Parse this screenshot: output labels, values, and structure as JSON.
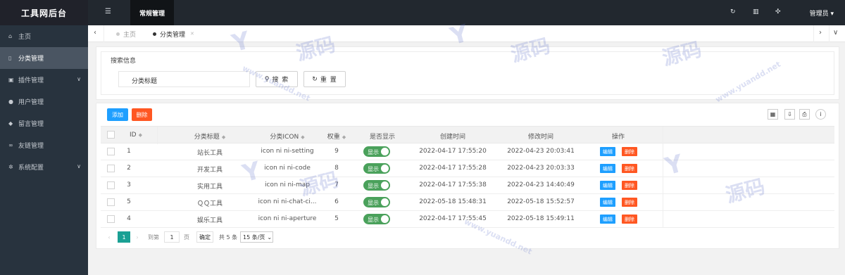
{
  "app": {
    "title": "工具网后台"
  },
  "sidebar": {
    "items": [
      {
        "label": "主页",
        "icon": "home-icon"
      },
      {
        "label": "分类管理",
        "icon": "bookmark-icon",
        "active": true
      },
      {
        "label": "插件管理",
        "icon": "sitemap-icon",
        "expandable": true
      },
      {
        "label": "用户管理",
        "icon": "user-icon"
      },
      {
        "label": "留言管理",
        "icon": "comments-icon"
      },
      {
        "label": "友链管理",
        "icon": "link-icon"
      },
      {
        "label": "系统配置",
        "icon": "cogs-icon",
        "expandable": true
      }
    ]
  },
  "header": {
    "top_tab": "常规管理",
    "admin_label": "管理员",
    "icons": [
      "refresh-icon",
      "trash-icon",
      "fullscreen-icon"
    ]
  },
  "tabs": {
    "items": [
      {
        "label": "主页",
        "active": false
      },
      {
        "label": "分类管理",
        "active": true
      }
    ]
  },
  "search": {
    "legend": "搜索信息",
    "field_label": "分类标题",
    "search_label": "搜 索",
    "reset_label": "重 置"
  },
  "toolbar": {
    "add_label": "添加",
    "delete_label": "删除",
    "add_color": "#1e9fff",
    "delete_color": "#ff5722"
  },
  "table": {
    "headers": [
      "ID",
      "分类标题",
      "分类ICON",
      "权重",
      "是否显示",
      "创建时间",
      "修改时间",
      "操作"
    ],
    "rows": [
      {
        "id": "1",
        "title": "站长工具",
        "icon": "icon ni ni-setting",
        "weight": "9",
        "show": "显示",
        "created": "2022-04-17 17:55:20",
        "modified": "2022-04-23 20:03:41"
      },
      {
        "id": "2",
        "title": "开发工具",
        "icon": "icon ni ni-code",
        "weight": "8",
        "show": "显示",
        "created": "2022-04-17 17:55:28",
        "modified": "2022-04-23 20:03:33"
      },
      {
        "id": "3",
        "title": "实用工具",
        "icon": "icon ni ni-map",
        "weight": "7",
        "show": "显示",
        "created": "2022-04-17 17:55:38",
        "modified": "2022-04-23 14:40:49"
      },
      {
        "id": "5",
        "title": "ＱＱ工具",
        "icon": "icon ni ni-chat-ci...",
        "weight": "6",
        "show": "显示",
        "created": "2022-05-18 15:48:31",
        "modified": "2022-05-18 15:52:57"
      },
      {
        "id": "4",
        "title": "娱乐工具",
        "icon": "icon ni ni-aperture",
        "weight": "5",
        "show": "显示",
        "created": "2022-04-17 17:55:45",
        "modified": "2022-05-18 15:49:11"
      }
    ],
    "edit_label": "编辑",
    "delete_label": "删除",
    "switch_color": "#4aa15b"
  },
  "pager": {
    "current": "1",
    "goto_label": "到第",
    "goto_value": "1",
    "page_label": "页",
    "confirm_label": "确定",
    "total_label": "共 5 条",
    "page_size": "15 条/页",
    "accent": "#1aa094"
  },
  "watermark": {
    "text": "源码",
    "url": "www.yuandd.net"
  }
}
